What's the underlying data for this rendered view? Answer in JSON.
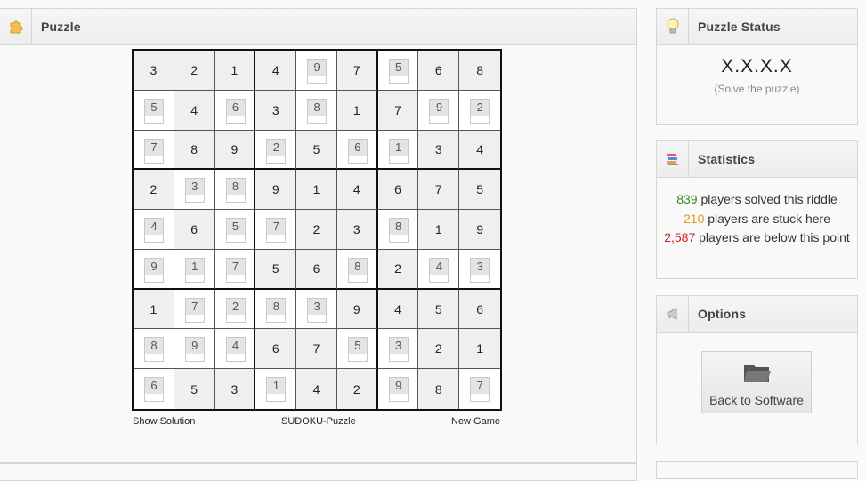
{
  "puzzle_panel": {
    "title": "Puzzle",
    "icon": "puzzle-piece-icon"
  },
  "board": {
    "rows": [
      [
        {
          "v": "3",
          "g": true
        },
        {
          "v": "2",
          "g": true
        },
        {
          "v": "1",
          "g": true
        },
        {
          "v": "4",
          "g": true
        },
        {
          "v": "9",
          "g": false
        },
        {
          "v": "7",
          "g": true
        },
        {
          "v": "5",
          "g": false
        },
        {
          "v": "6",
          "g": true
        },
        {
          "v": "8",
          "g": true
        }
      ],
      [
        {
          "v": "5",
          "g": false
        },
        {
          "v": "4",
          "g": true
        },
        {
          "v": "6",
          "g": false
        },
        {
          "v": "3",
          "g": true
        },
        {
          "v": "8",
          "g": false
        },
        {
          "v": "1",
          "g": true
        },
        {
          "v": "7",
          "g": true
        },
        {
          "v": "9",
          "g": false
        },
        {
          "v": "2",
          "g": false
        }
      ],
      [
        {
          "v": "7",
          "g": false
        },
        {
          "v": "8",
          "g": true
        },
        {
          "v": "9",
          "g": true
        },
        {
          "v": "2",
          "g": false
        },
        {
          "v": "5",
          "g": true
        },
        {
          "v": "6",
          "g": false
        },
        {
          "v": "1",
          "g": false
        },
        {
          "v": "3",
          "g": true
        },
        {
          "v": "4",
          "g": true
        }
      ],
      [
        {
          "v": "2",
          "g": true
        },
        {
          "v": "3",
          "g": false
        },
        {
          "v": "8",
          "g": false
        },
        {
          "v": "9",
          "g": true
        },
        {
          "v": "1",
          "g": true
        },
        {
          "v": "4",
          "g": true
        },
        {
          "v": "6",
          "g": true
        },
        {
          "v": "7",
          "g": true
        },
        {
          "v": "5",
          "g": true
        }
      ],
      [
        {
          "v": "4",
          "g": false
        },
        {
          "v": "6",
          "g": true
        },
        {
          "v": "5",
          "g": false
        },
        {
          "v": "7",
          "g": false
        },
        {
          "v": "2",
          "g": true
        },
        {
          "v": "3",
          "g": true
        },
        {
          "v": "8",
          "g": false
        },
        {
          "v": "1",
          "g": true
        },
        {
          "v": "9",
          "g": true
        }
      ],
      [
        {
          "v": "9",
          "g": false
        },
        {
          "v": "1",
          "g": false
        },
        {
          "v": "7",
          "g": false
        },
        {
          "v": "5",
          "g": true
        },
        {
          "v": "6",
          "g": true
        },
        {
          "v": "8",
          "g": false
        },
        {
          "v": "2",
          "g": true
        },
        {
          "v": "4",
          "g": false
        },
        {
          "v": "3",
          "g": false
        }
      ],
      [
        {
          "v": "1",
          "g": true
        },
        {
          "v": "7",
          "g": false
        },
        {
          "v": "2",
          "g": false
        },
        {
          "v": "8",
          "g": false
        },
        {
          "v": "3",
          "g": false
        },
        {
          "v": "9",
          "g": true
        },
        {
          "v": "4",
          "g": true
        },
        {
          "v": "5",
          "g": true
        },
        {
          "v": "6",
          "g": true
        }
      ],
      [
        {
          "v": "8",
          "g": false
        },
        {
          "v": "9",
          "g": false
        },
        {
          "v": "4",
          "g": false
        },
        {
          "v": "6",
          "g": true
        },
        {
          "v": "7",
          "g": true
        },
        {
          "v": "5",
          "g": false
        },
        {
          "v": "3",
          "g": false
        },
        {
          "v": "2",
          "g": true
        },
        {
          "v": "1",
          "g": true
        }
      ],
      [
        {
          "v": "6",
          "g": false
        },
        {
          "v": "5",
          "g": true
        },
        {
          "v": "3",
          "g": true
        },
        {
          "v": "1",
          "g": false
        },
        {
          "v": "4",
          "g": true
        },
        {
          "v": "2",
          "g": true
        },
        {
          "v": "9",
          "g": false
        },
        {
          "v": "8",
          "g": true
        },
        {
          "v": "7",
          "g": false
        }
      ]
    ],
    "show_solution": "Show Solution",
    "caption": "SUDOKU-Puzzle",
    "new_game": "New Game"
  },
  "status_panel": {
    "title": "Puzzle Status",
    "icon": "lightbulb-icon",
    "code": "X.X.X.X",
    "subtitle": "(Solve the puzzle)"
  },
  "stats_panel": {
    "title": "Statistics",
    "icon": "books-icon",
    "solved_count": "839",
    "solved_text": " players solved this riddle",
    "stuck_count": "210",
    "stuck_text": " players are stuck here",
    "below_count": "2,587",
    "below_text": " players are below this point"
  },
  "options_panel": {
    "title": "Options",
    "icon": "megaphone-icon",
    "back_label": "Back to Software"
  },
  "colors": {
    "solved": "#3a8a14",
    "stuck": "#d89b1c",
    "below": "#cc2222"
  }
}
